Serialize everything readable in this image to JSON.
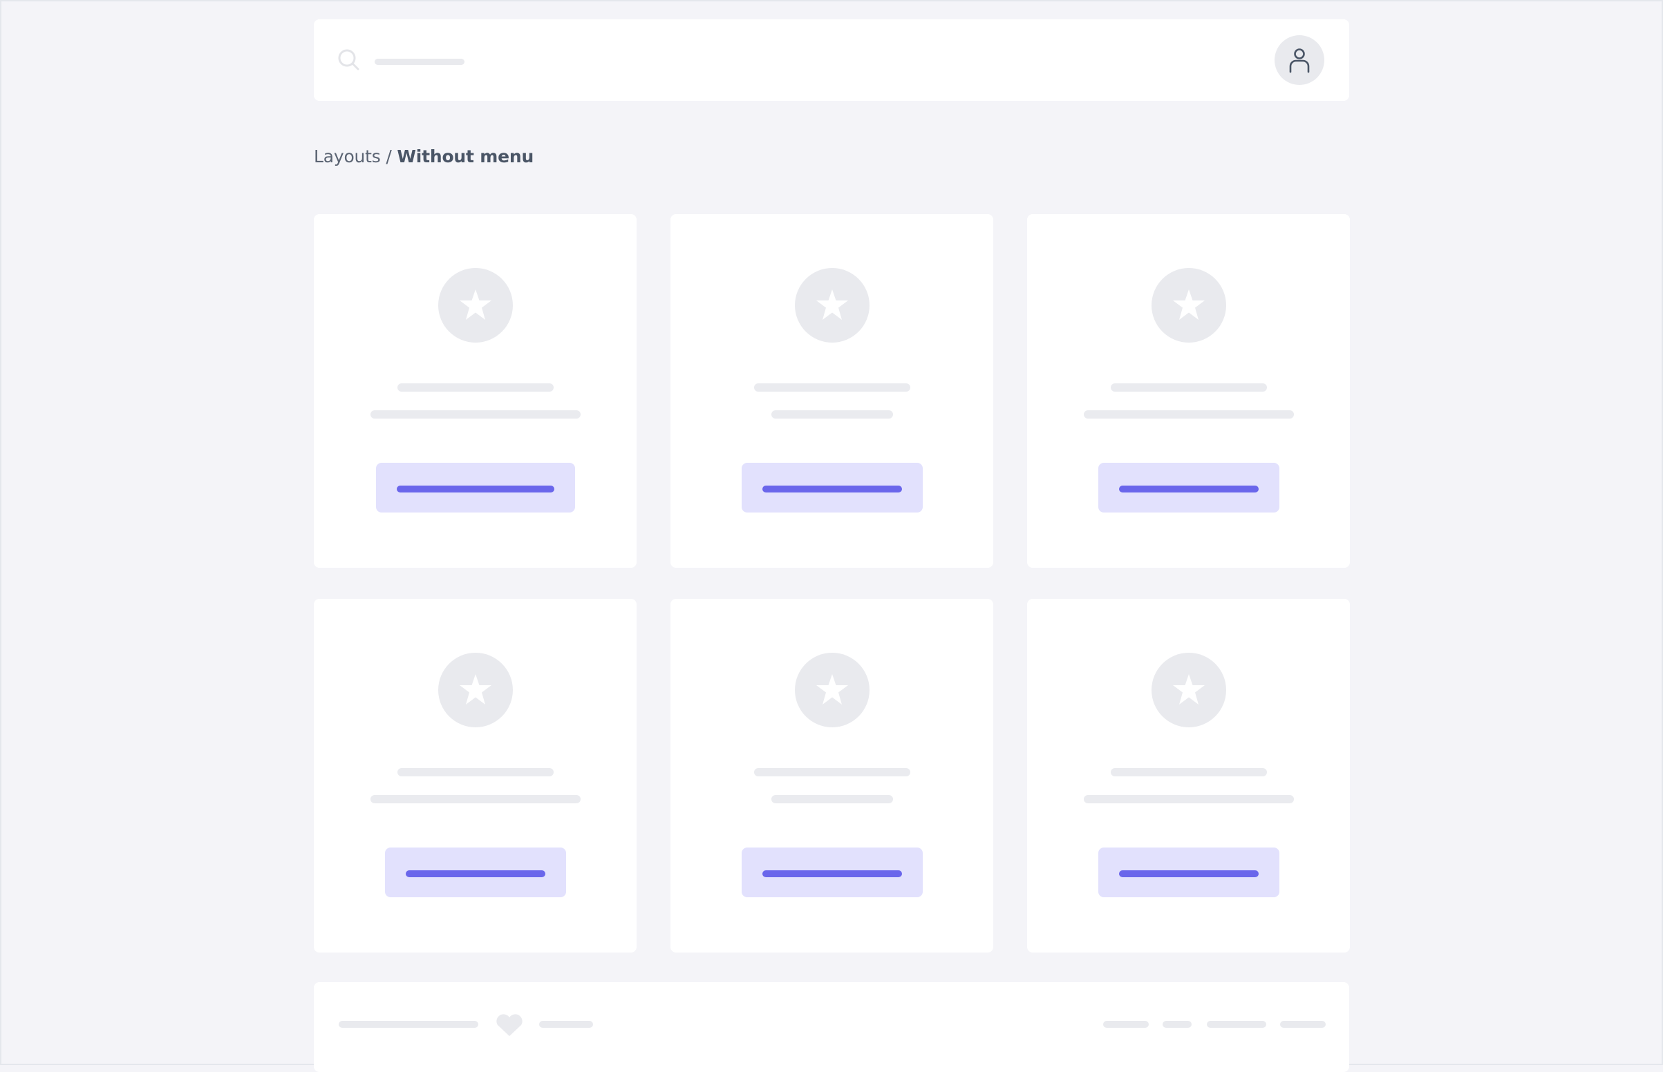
{
  "breadcrumb": {
    "parent": "Layouts",
    "separator": "/",
    "current": "Without menu"
  },
  "header": {
    "search_icon": "search-icon",
    "avatar_icon": "user-icon"
  },
  "cards": [
    {
      "icon": "star-icon"
    },
    {
      "icon": "star-icon"
    },
    {
      "icon": "star-icon"
    },
    {
      "icon": "star-icon"
    },
    {
      "icon": "star-icon"
    },
    {
      "icon": "star-icon"
    }
  ],
  "footer": {
    "icon": "heart-icon"
  },
  "colors": {
    "background": "#f4f4f8",
    "surface": "#ffffff",
    "placeholder": "#e9eaee",
    "button_bg": "#e2e1fd",
    "accent": "#6a66eb",
    "text": "#5b6473"
  }
}
